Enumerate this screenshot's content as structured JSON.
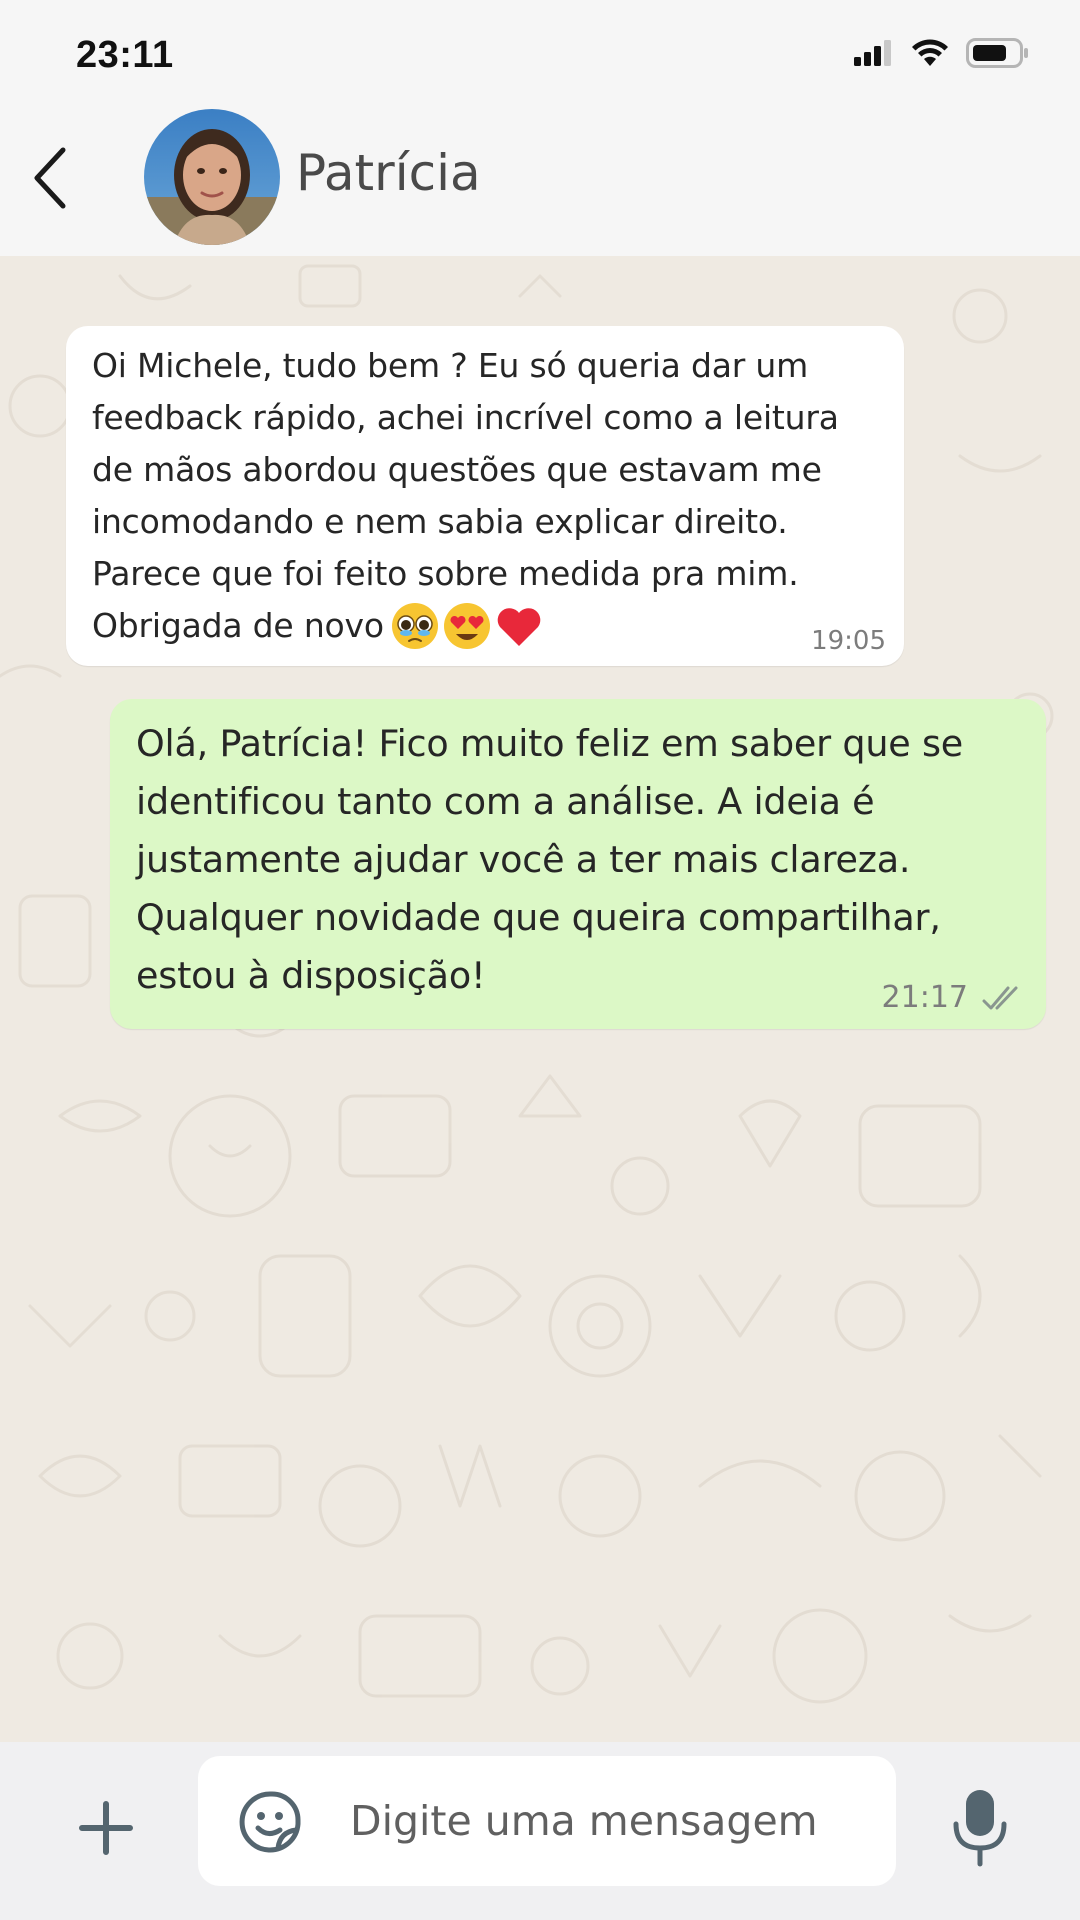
{
  "status_bar": {
    "time": "23:11",
    "icons": [
      "signal-icon",
      "wifi-icon",
      "battery-icon"
    ]
  },
  "header": {
    "contact_name": "Patrícia",
    "back_icon": "chevron-left-icon"
  },
  "messages": [
    {
      "direction": "incoming",
      "text": "Oi Michele, tudo bem ? Eu só queria dar um\nfeedback rápido, achei incrível como a leitura\nde mãos abordou questões que estavam me\nincomodando e nem sabia explicar direito.\nParece que foi feito sobre medida pra mim.\nObrigada de novo",
      "emojis": [
        "teary-eyes-emoji",
        "heart-eyes-emoji",
        "red-heart-emoji"
      ],
      "time": "19:05"
    },
    {
      "direction": "outgoing",
      "text": "Olá, Patrícia! Fico muito feliz em saber que se\nidentificou tanto com a análise. A ideia é\njustamente ajudar você a ter mais clareza.\nQualquer novidade que queira compartilhar,\nestou à disposição!",
      "time": "21:17",
      "status_icon": "double-check-icon"
    }
  ],
  "input_bar": {
    "placeholder": "Digite uma mensagem",
    "value": "",
    "left_icon": "plus-icon",
    "sticker_icon": "sticker-icon",
    "right_icon": "microphone-icon"
  },
  "colors": {
    "incoming_bubble": "#ffffff",
    "outgoing_bubble": "#dcf8c6",
    "chat_background": "#efeae2",
    "header_background": "#f6f6f6",
    "icon_gray": "#54656f"
  }
}
